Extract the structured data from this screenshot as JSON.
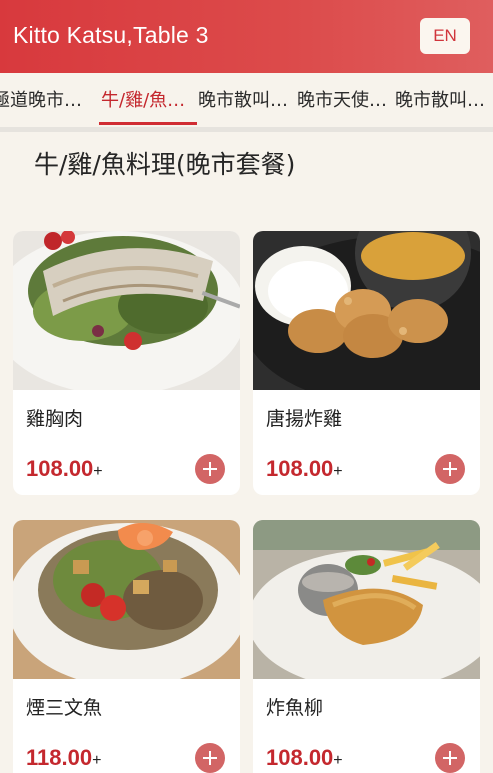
{
  "header": {
    "title": "Kitto Katsu,Table 3",
    "lang_button": "EN"
  },
  "tabs": [
    {
      "label": "極道晚市…",
      "active": false
    },
    {
      "label": "牛/雞/魚…",
      "active": true
    },
    {
      "label": "晚市散叫…",
      "active": false
    },
    {
      "label": "晚市天使…",
      "active": false
    },
    {
      "label": "晚市散叫…",
      "active": false
    }
  ],
  "section": {
    "title": "牛/雞/魚料理(晚市套餐)"
  },
  "items": [
    {
      "name": "雞胸肉",
      "price": "108.00",
      "price_suffix": "+",
      "photo": "chicken-breast-salad-photo"
    },
    {
      "name": "唐揚炸雞",
      "price": "108.00",
      "price_suffix": "+",
      "photo": "fried-chicken-curry-photo"
    },
    {
      "name": "煙三文魚",
      "price": "118.00",
      "price_suffix": "+",
      "photo": "smoked-salmon-salad-photo"
    },
    {
      "name": "炸魚柳",
      "price": "108.00",
      "price_suffix": "+",
      "photo": "fish-fillet-fries-photo"
    }
  ],
  "colors": {
    "brand_red": "#d8393d",
    "price_red": "#c4282e",
    "add_button": "#d26565"
  }
}
